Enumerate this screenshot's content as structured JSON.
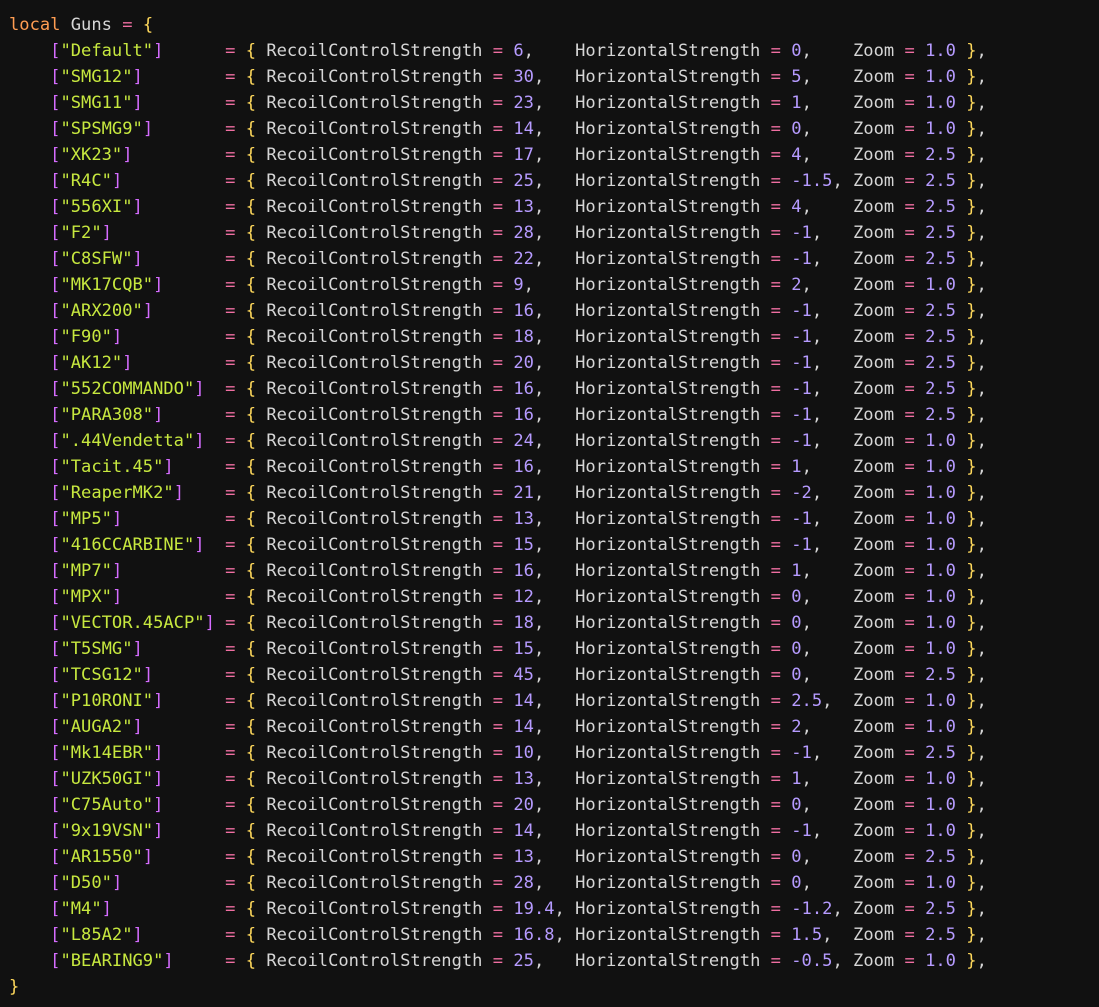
{
  "code": {
    "header": {
      "keyword": "local",
      "name": "Guns",
      "assign": "=",
      "open_brace": "{"
    },
    "footer": {
      "close_brace": "}"
    },
    "field_names": {
      "recoil": "RecoilControlStrength",
      "horizontal": "HorizontalStrength",
      "zoom": "Zoom"
    },
    "entries": [
      {
        "name": "Default",
        "recoil": "6",
        "horizontal": "0",
        "zoom": "1.0"
      },
      {
        "name": "SMG12",
        "recoil": "30",
        "horizontal": "5",
        "zoom": "1.0"
      },
      {
        "name": "SMG11",
        "recoil": "23",
        "horizontal": "1",
        "zoom": "1.0"
      },
      {
        "name": "SPSMG9",
        "recoil": "14",
        "horizontal": "0",
        "zoom": "1.0"
      },
      {
        "name": "XK23",
        "recoil": "17",
        "horizontal": "4",
        "zoom": "2.5"
      },
      {
        "name": "R4C",
        "recoil": "25",
        "horizontal": "-1.5",
        "zoom": "2.5"
      },
      {
        "name": "556XI",
        "recoil": "13",
        "horizontal": "4",
        "zoom": "2.5"
      },
      {
        "name": "F2",
        "recoil": "28",
        "horizontal": "-1",
        "zoom": "2.5"
      },
      {
        "name": "C8SFW",
        "recoil": "22",
        "horizontal": "-1",
        "zoom": "2.5"
      },
      {
        "name": "MK17CQB",
        "recoil": "9",
        "horizontal": "2",
        "zoom": "1.0"
      },
      {
        "name": "ARX200",
        "recoil": "16",
        "horizontal": "-1",
        "zoom": "2.5"
      },
      {
        "name": "F90",
        "recoil": "18",
        "horizontal": "-1",
        "zoom": "2.5"
      },
      {
        "name": "AK12",
        "recoil": "20",
        "horizontal": "-1",
        "zoom": "2.5"
      },
      {
        "name": "552COMMANDO",
        "recoil": "16",
        "horizontal": "-1",
        "zoom": "2.5"
      },
      {
        "name": "PARA308",
        "recoil": "16",
        "horizontal": "-1",
        "zoom": "2.5"
      },
      {
        "name": ".44Vendetta",
        "recoil": "24",
        "horizontal": "-1",
        "zoom": "1.0"
      },
      {
        "name": "Tacit.45",
        "recoil": "16",
        "horizontal": "1",
        "zoom": "1.0"
      },
      {
        "name": "ReaperMK2",
        "recoil": "21",
        "horizontal": "-2",
        "zoom": "1.0"
      },
      {
        "name": "MP5",
        "recoil": "13",
        "horizontal": "-1",
        "zoom": "1.0"
      },
      {
        "name": "416CCARBINE",
        "recoil": "15",
        "horizontal": "-1",
        "zoom": "1.0"
      },
      {
        "name": "MP7",
        "recoil": "16",
        "horizontal": "1",
        "zoom": "1.0"
      },
      {
        "name": "MPX",
        "recoil": "12",
        "horizontal": "0",
        "zoom": "1.0"
      },
      {
        "name": "VECTOR.45ACP",
        "recoil": "18",
        "horizontal": "0",
        "zoom": "1.0"
      },
      {
        "name": "T5SMG",
        "recoil": "15",
        "horizontal": "0",
        "zoom": "1.0"
      },
      {
        "name": "TCSG12",
        "recoil": "45",
        "horizontal": "0",
        "zoom": "2.5"
      },
      {
        "name": "P10RONI",
        "recoil": "14",
        "horizontal": "2.5",
        "zoom": "1.0"
      },
      {
        "name": "AUGA2",
        "recoil": "14",
        "horizontal": "2",
        "zoom": "1.0"
      },
      {
        "name": "Mk14EBR",
        "recoil": "10",
        "horizontal": "-1",
        "zoom": "2.5"
      },
      {
        "name": "UZK50GI",
        "recoil": "13",
        "horizontal": "1",
        "zoom": "1.0"
      },
      {
        "name": "C75Auto",
        "recoil": "20",
        "horizontal": "0",
        "zoom": "1.0"
      },
      {
        "name": "9x19VSN",
        "recoil": "14",
        "horizontal": "-1",
        "zoom": "1.0"
      },
      {
        "name": "AR1550",
        "recoil": "13",
        "horizontal": "0",
        "zoom": "2.5"
      },
      {
        "name": "D50",
        "recoil": "28",
        "horizontal": "0",
        "zoom": "1.0"
      },
      {
        "name": "M4",
        "recoil": "19.4",
        "horizontal": "-1.2",
        "zoom": "2.5"
      },
      {
        "name": "L85A2",
        "recoil": "16.8",
        "horizontal": "1.5",
        "zoom": "2.5"
      },
      {
        "name": "BEARING9",
        "recoil": "25",
        "horizontal": "-0.5",
        "zoom": "1.0"
      }
    ]
  },
  "colors": {
    "background": "#111111",
    "keyword": "#ff9d52",
    "operator": "#f06fa2",
    "brace": "#ffd95c",
    "bracket": "#d56cff",
    "string": "#c7e83f",
    "number": "#b69bff",
    "identifier": "#d6d6d6"
  }
}
